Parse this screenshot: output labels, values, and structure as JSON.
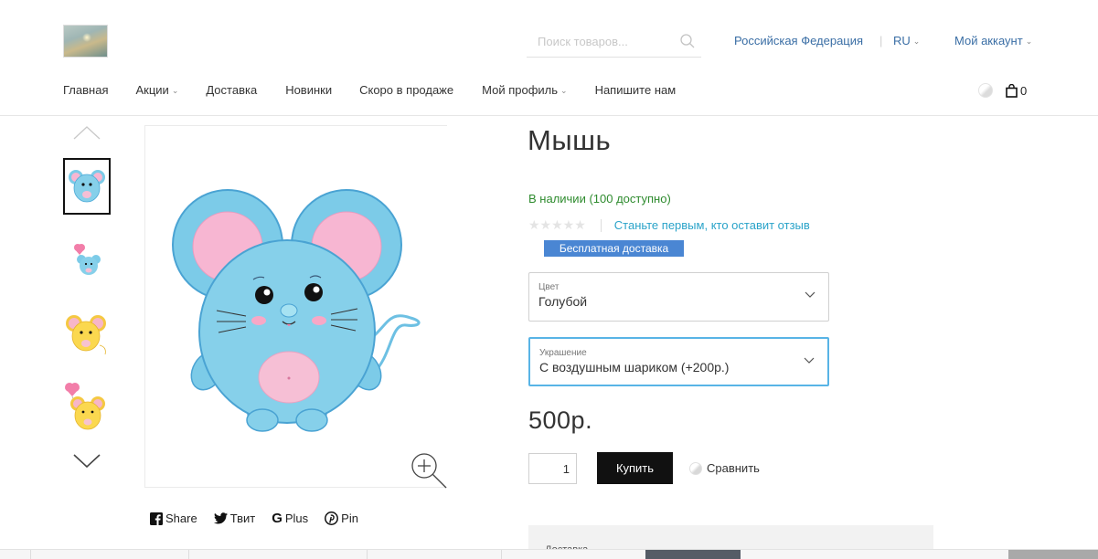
{
  "header": {
    "search_placeholder": "Поиск товаров...",
    "country": "Российская Федерация",
    "lang": "RU",
    "account": "Мой аккаунт",
    "cart_count": "0"
  },
  "nav": {
    "items": [
      {
        "label": "Главная",
        "dropdown": false
      },
      {
        "label": "Акции",
        "dropdown": true
      },
      {
        "label": "Доставка",
        "dropdown": false
      },
      {
        "label": "Новинки",
        "dropdown": false
      },
      {
        "label": "Скоро в продаже",
        "dropdown": false
      },
      {
        "label": "Мой профиль",
        "dropdown": true
      },
      {
        "label": "Напишите нам",
        "dropdown": false
      }
    ]
  },
  "product": {
    "title": "Мышь",
    "stock": "В наличии (100 доступно)",
    "rating_stars": 0,
    "review_link": "Станьте первым, кто оставит отзыв",
    "badge": "Бесплатная доставка",
    "options": [
      {
        "label": "Цвет",
        "value": "Голубой"
      },
      {
        "label": "Украшение",
        "value": "С воздушным шариком (+200р.)"
      }
    ],
    "price": "500р.",
    "qty": "1",
    "buy_label": "Купить",
    "compare_label": "Сравнить",
    "delivery_title": "Доставка"
  },
  "share": {
    "facebook": "Share",
    "twitter": "Твит",
    "google": "Plus",
    "pinterest": "Pin"
  },
  "colors": {
    "link": "#3a6ea5",
    "stock": "#2e8b2e",
    "badge": "#4a86d3",
    "focus": "#58b4e6",
    "button": "#111111"
  }
}
